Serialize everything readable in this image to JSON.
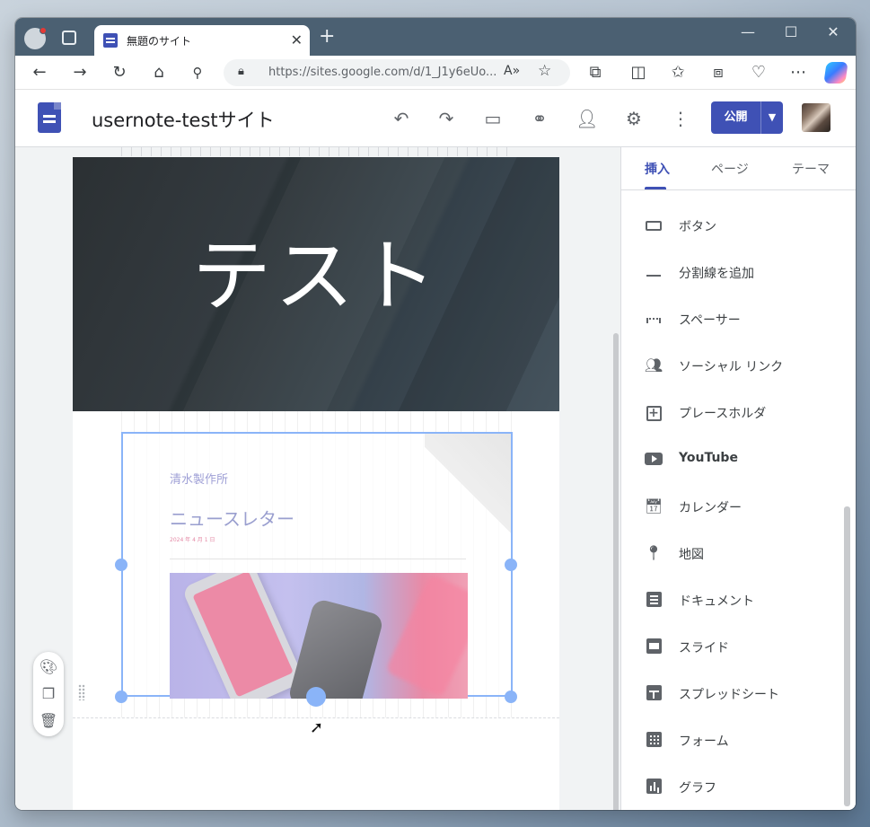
{
  "browser": {
    "tab_title": "無題のサイト",
    "url": "https://sites.google.com/d/1_J1y6eUo...",
    "icons": [
      "profile-icon",
      "tab-actions-icon",
      "back-icon",
      "forward-icon",
      "refresh-icon",
      "home-icon",
      "search-icon",
      "lock-icon",
      "read-aloud-icon",
      "favorite-icon",
      "extensions-icon",
      "split-screen-icon",
      "favorites-icon",
      "collections-icon",
      "browser-essentials-icon",
      "more-icon",
      "copilot-icon"
    ]
  },
  "header": {
    "site_name": "usernote-testサイト",
    "publish_label": "公開"
  },
  "page": {
    "hero_title": "テスト",
    "embed": {
      "company": "清水製作所",
      "newsletter": "ニュースレター",
      "date": "2024 年 4 月 1 日"
    }
  },
  "panel": {
    "tabs": [
      "挿入",
      "ページ",
      "テーマ"
    ],
    "active_tab": "挿入",
    "items": [
      {
        "label": "ボタン",
        "icon": "button-icon"
      },
      {
        "label": "分割線を追加",
        "icon": "divider-icon"
      },
      {
        "label": "スペーサー",
        "icon": "spacer-icon"
      },
      {
        "label": "ソーシャル リンク",
        "icon": "social-links-icon"
      },
      {
        "label": "プレースホルダ",
        "icon": "placeholder-icon"
      },
      {
        "label": "YouTube",
        "icon": "youtube-icon"
      },
      {
        "label": "カレンダー",
        "icon": "calendar-icon"
      },
      {
        "label": "地図",
        "icon": "map-icon"
      },
      {
        "label": "ドキュメント",
        "icon": "docs-icon"
      },
      {
        "label": "スライド",
        "icon": "slides-icon"
      },
      {
        "label": "スプレッドシート",
        "icon": "sheets-icon"
      },
      {
        "label": "フォーム",
        "icon": "forms-icon"
      },
      {
        "label": "グラフ",
        "icon": "chart-icon"
      }
    ]
  },
  "colors": {
    "accent": "#3f51b5",
    "selection": "#8ab4f8",
    "titlebar": "#4b6072"
  }
}
